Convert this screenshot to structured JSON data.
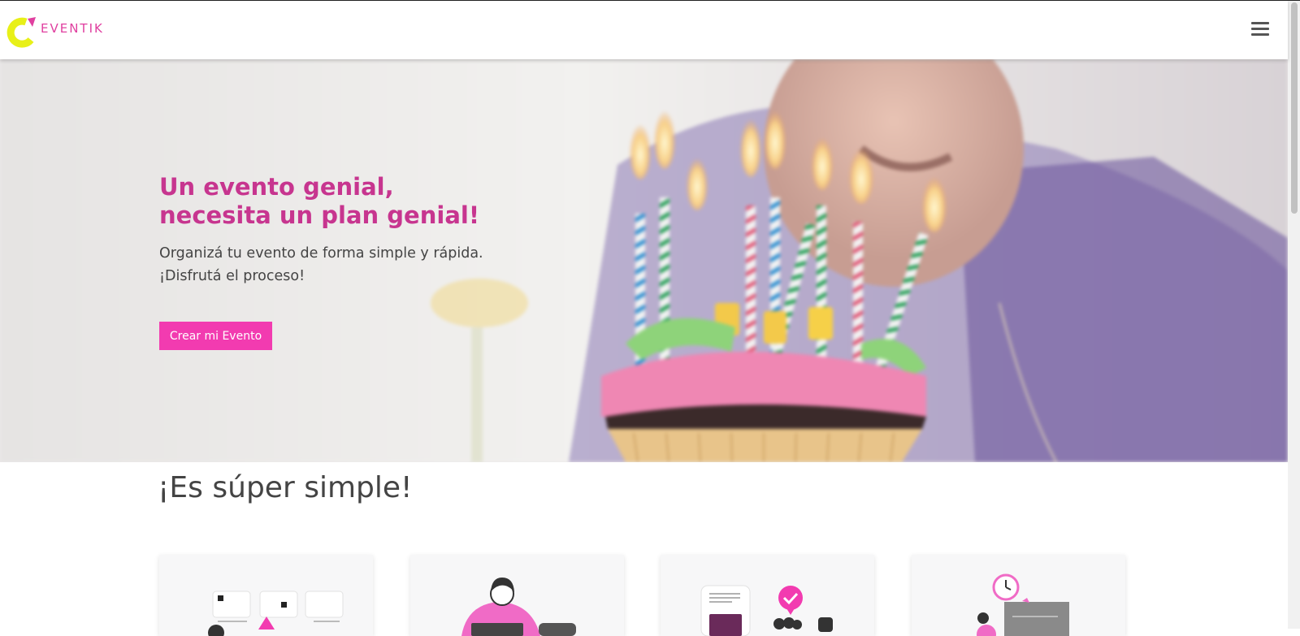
{
  "header": {
    "brand_name": "EVENTIK",
    "logo_icon": "eventik-logo-icon",
    "menu_icon": "hamburger-menu-icon"
  },
  "hero": {
    "title_lines": [
      "Un evento genial,",
      "necesita un plan genial!"
    ],
    "subtitle_lines": [
      "Organizá tu evento de forma simple y rápida.",
      "¡Disfrutá el proceso!"
    ],
    "cta_label": "Crear mi Evento",
    "background": "birthday-cupcake-candles-photo"
  },
  "section": {
    "title": "¡Es súper simple!",
    "cards": [
      {
        "illustration": "calendar-planning-illustration"
      },
      {
        "illustration": "person-laptop-illustration"
      },
      {
        "illustration": "checklist-chat-illustration"
      },
      {
        "illustration": "clock-schedule-illustration"
      }
    ]
  },
  "colors": {
    "brand_pink": "#e040a0",
    "title_pink": "#c7358f",
    "cta_pink": "#f23bb0",
    "logo_yellow": "#e8f018"
  }
}
